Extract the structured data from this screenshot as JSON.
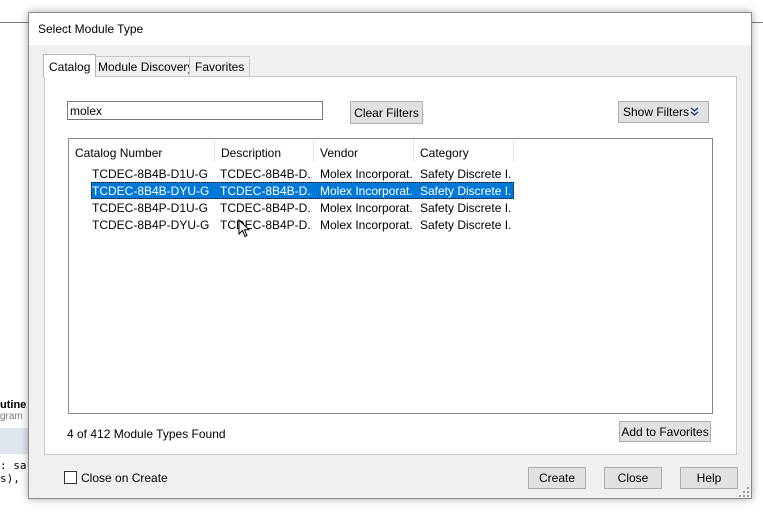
{
  "background": {
    "bold_label": "utine",
    "gray_label": "gram",
    "code_line_1": ": sa",
    "code_line_2": "s),"
  },
  "dialog": {
    "title": "Select Module Type",
    "tabs": [
      {
        "label": "Catalog",
        "active": true
      },
      {
        "label": "Module Discovery",
        "active": false
      },
      {
        "label": "Favorites",
        "active": false
      }
    ],
    "search": {
      "value": "molex",
      "placeholder": ""
    },
    "clear_filters_label": "Clear Filters",
    "show_filters_label": "Show Filters",
    "show_filters_icon": "double-chevron-down-icon",
    "table": {
      "columns": [
        "Catalog Number",
        "Description",
        "Vendor",
        "Category"
      ],
      "rows": [
        {
          "catalog": "TCDEC-8B4B-D1U-G",
          "description": "TCDEC-8B4B-D...",
          "vendor": "Molex Incorporat...",
          "category": "Safety Discrete I...",
          "selected": false
        },
        {
          "catalog": "TCDEC-8B4B-DYU-G",
          "description": "TCDEC-8B4B-D...",
          "vendor": "Molex Incorporat...",
          "category": "Safety Discrete I...",
          "selected": true
        },
        {
          "catalog": "TCDEC-8B4P-D1U-G",
          "description": "TCDEC-8B4P-D...",
          "vendor": "Molex Incorporat...",
          "category": "Safety Discrete I...",
          "selected": false
        },
        {
          "catalog": "TCDEC-8B4P-DYU-G",
          "description": "TCDEC-8B4P-D...",
          "vendor": "Molex Incorporat...",
          "category": "Safety Discrete I...",
          "selected": false
        }
      ]
    },
    "status_text": "4  of 412 Module Types Found",
    "add_to_favorites_label": "Add to Favorites",
    "close_on_create_label": "Close on Create",
    "close_on_create_checked": false,
    "buttons": {
      "create": "Create",
      "close": "Close",
      "help": "Help"
    },
    "colors": {
      "selection": "#0078d7",
      "background": "#f0f0f0"
    }
  }
}
